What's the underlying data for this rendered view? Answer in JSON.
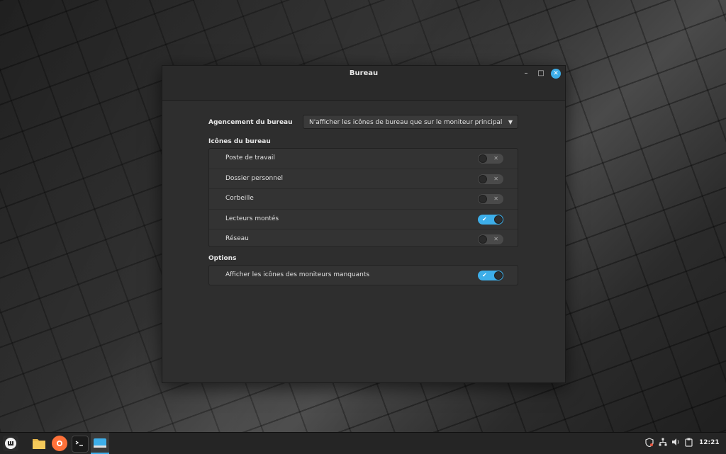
{
  "window": {
    "title": "Bureau",
    "minimize_glyph": "–",
    "maximize_glyph": "□",
    "close_glyph": "✕"
  },
  "layout_setting": {
    "label": "Agencement du bureau",
    "selected": "N'afficher les icônes de bureau que sur le moniteur principal",
    "arrow": "▼"
  },
  "desktop_icons": {
    "title": "Icônes du bureau",
    "items": [
      {
        "label": "Poste de travail",
        "enabled": false
      },
      {
        "label": "Dossier personnel",
        "enabled": false
      },
      {
        "label": "Corbeille",
        "enabled": false
      },
      {
        "label": "Lecteurs montés",
        "enabled": true
      },
      {
        "label": "Réseau",
        "enabled": false
      }
    ]
  },
  "options": {
    "title": "Options",
    "items": [
      {
        "label": "Afficher les icônes des moniteurs manquants",
        "enabled": true
      }
    ]
  },
  "toggle_marks": {
    "on": "✔",
    "off": "✕"
  },
  "taskbar": {
    "menu_icon": "mint-menu-icon",
    "apps": [
      "files-icon",
      "firefox-icon",
      "terminal-icon",
      "desktop-icon"
    ],
    "tray": [
      "shield-icon",
      "network-icon",
      "volume-icon",
      "clipboard-icon"
    ],
    "clock": "12:21"
  },
  "colors": {
    "accent": "#3daee9",
    "window_bg": "#2e2e2e",
    "taskbar_bg": "#252525"
  }
}
